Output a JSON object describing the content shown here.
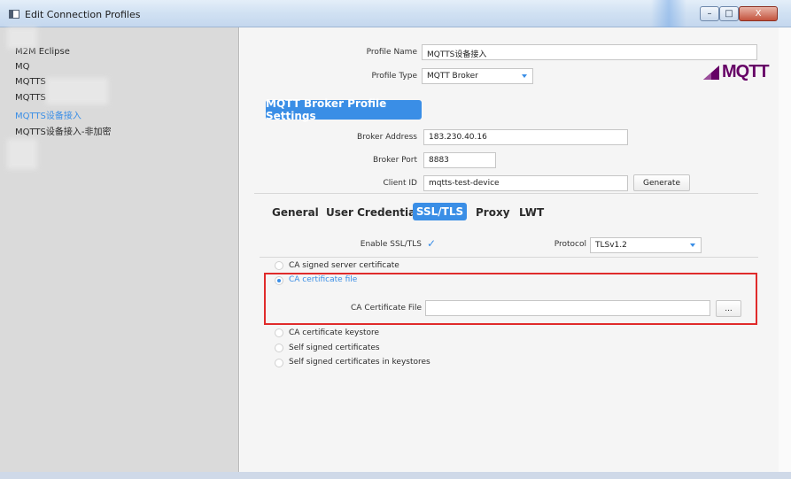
{
  "window": {
    "title": "Edit Connection Profiles",
    "controls": {
      "minimize": "–",
      "maximize": "□",
      "close": "X"
    }
  },
  "sidebar": {
    "items": [
      {
        "label": "M2M Eclipse"
      },
      {
        "label": "MQ"
      },
      {
        "label": "MQTTS"
      },
      {
        "label": "MQTTS"
      },
      {
        "label": "MQTTS设备接入",
        "selected": true
      },
      {
        "label": "MQTTS设备接入-非加密"
      }
    ]
  },
  "profile": {
    "name_label": "Profile Name",
    "name_value": "MQTTS设备接入",
    "type_label": "Profile Type",
    "type_value": "MQTT Broker",
    "logo_text": "MQTT",
    "settings_header": "MQTT Broker Profile Settings",
    "broker_address_label": "Broker Address",
    "broker_address_value": "183.230.40.16",
    "broker_port_label": "Broker Port",
    "broker_port_value": "8883",
    "client_id_label": "Client ID",
    "client_id_value": "mqtts-test-device",
    "generate_label": "Generate"
  },
  "tabs": [
    {
      "label": "General"
    },
    {
      "label": "User Credentials"
    },
    {
      "label": "SSL/TLS",
      "active": true
    },
    {
      "label": "Proxy"
    },
    {
      "label": "LWT"
    }
  ],
  "ssl": {
    "enable_label": "Enable SSL/TLS",
    "enable_checked": "✓",
    "protocol_label": "Protocol",
    "protocol_value": "TLSv1.2",
    "options": [
      {
        "label": "CA signed server certificate",
        "selected": false
      },
      {
        "label": "CA certificate file",
        "selected": true
      },
      {
        "label": "CA certificate keystore",
        "selected": false
      },
      {
        "label": "Self signed certificates",
        "selected": false
      },
      {
        "label": "Self signed certificates in keystores",
        "selected": false
      }
    ],
    "ca_file_label": "CA Certificate File",
    "ca_file_value": "",
    "browse_label": "..."
  },
  "colors": {
    "accent": "#3a8ee6",
    "highlight_box": "#e02b2b",
    "logo": "#660066"
  }
}
